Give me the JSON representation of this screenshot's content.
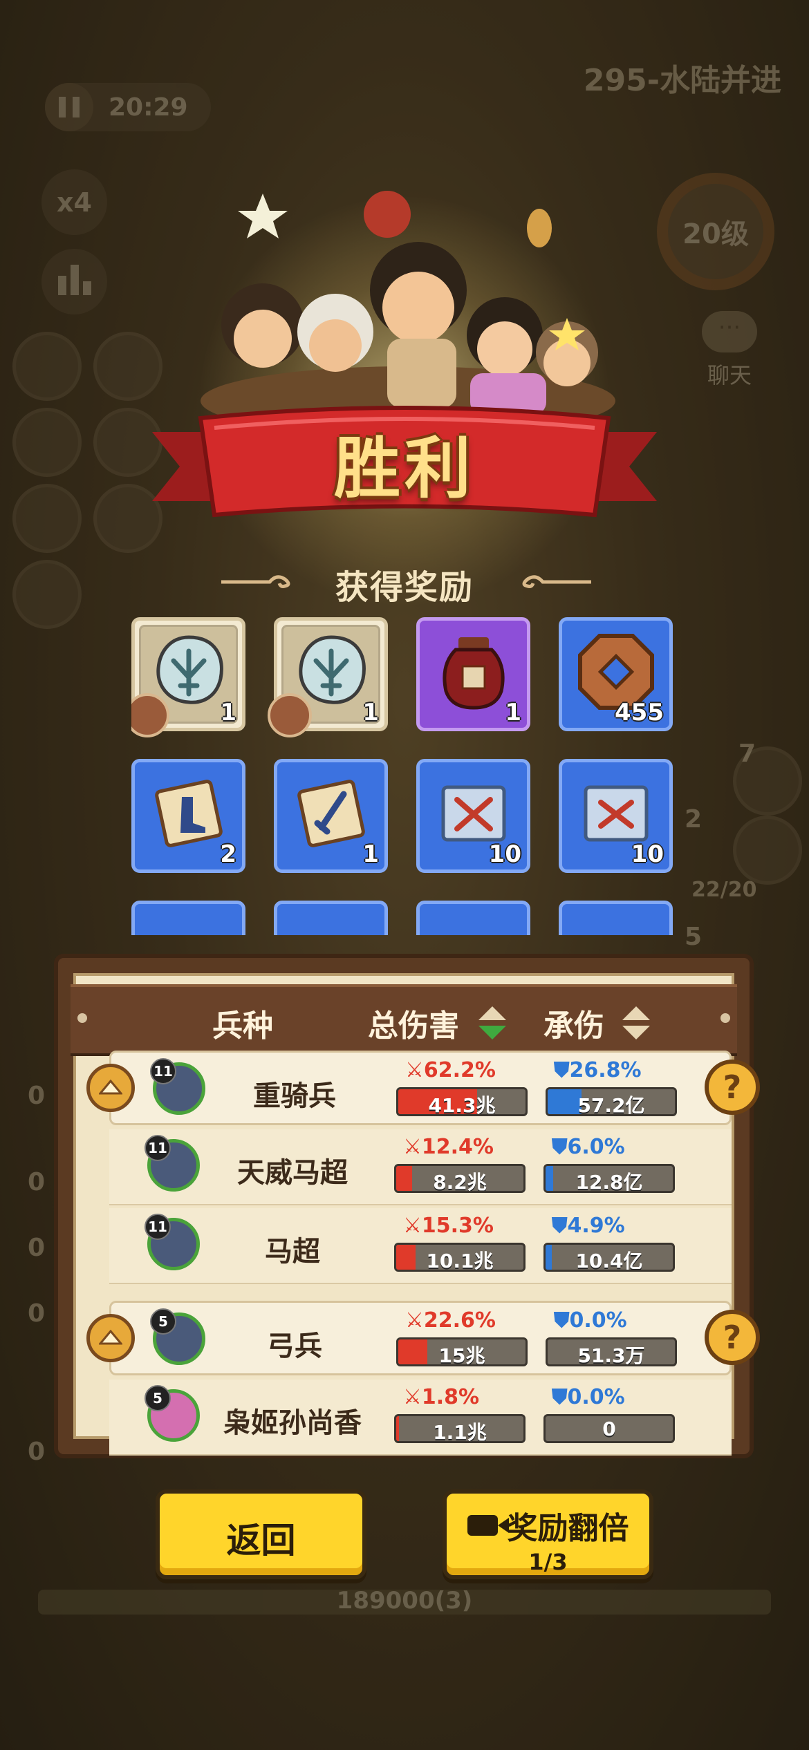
{
  "hud": {
    "stage_title": "295-水陆并进",
    "timer": "20:29",
    "speed": "x4",
    "level": "20级",
    "chat_label": "聊天",
    "side_numbers": [
      "7",
      "2",
      "22/20",
      "5",
      "0",
      "0",
      "0",
      "0",
      "0"
    ],
    "bottom_hp": "189000(3)"
  },
  "victory": {
    "title": "胜利",
    "reward_heading": "获得奖励"
  },
  "rewards": [
    {
      "icon": "trident-token-icon",
      "count": "1",
      "bg": "cream"
    },
    {
      "icon": "trident-token-icon",
      "count": "1",
      "bg": "cream"
    },
    {
      "icon": "wine-jar-icon",
      "count": "1",
      "bg": "purple"
    },
    {
      "icon": "copper-coin-icon",
      "count": "455",
      "bg": "blue"
    },
    {
      "icon": "boot-scroll-icon",
      "count": "2",
      "bg": "blue"
    },
    {
      "icon": "sword-scroll-icon",
      "count": "1",
      "bg": "blue"
    },
    {
      "icon": "crossbow-scroll-icon",
      "count": "10",
      "bg": "blue"
    },
    {
      "icon": "crossed-swords-scroll-icon",
      "count": "10",
      "bg": "blue"
    }
  ],
  "stats": {
    "headers": {
      "unit": "兵种",
      "damage": "总伤害",
      "taken": "承伤"
    },
    "rows": [
      {
        "type": "group",
        "level": "11",
        "name": "重骑兵",
        "dmg_pct": "62.2%",
        "dmg_val": "41.3兆",
        "dmg_frac": 0.622,
        "tak_pct": "26.8%",
        "tak_val": "57.2亿",
        "tak_frac": 0.268
      },
      {
        "type": "child",
        "level": "11",
        "name": "天威马超",
        "dmg_pct": "12.4%",
        "dmg_val": "8.2兆",
        "dmg_frac": 0.124,
        "tak_pct": "6.0%",
        "tak_val": "12.8亿",
        "tak_frac": 0.06
      },
      {
        "type": "child",
        "level": "11",
        "name": "马超",
        "dmg_pct": "15.3%",
        "dmg_val": "10.1兆",
        "dmg_frac": 0.153,
        "tak_pct": "4.9%",
        "tak_val": "10.4亿",
        "tak_frac": 0.049
      },
      {
        "type": "group",
        "level": "5",
        "name": "弓兵",
        "dmg_pct": "22.6%",
        "dmg_val": "15兆",
        "dmg_frac": 0.226,
        "tak_pct": "0.0%",
        "tak_val": "51.3万",
        "tak_frac": 0.0
      },
      {
        "type": "child",
        "level": "5",
        "name": "枭姬孙尚香",
        "dmg_pct": "1.8%",
        "dmg_val": "1.1兆",
        "dmg_frac": 0.018,
        "tak_pct": "0.0%",
        "tak_val": "0",
        "tak_frac": 0.0
      }
    ]
  },
  "buttons": {
    "back": "返回",
    "double": "奖励翻倍",
    "double_progress": "1/3"
  },
  "colors": {
    "damage": "#e03a2a",
    "taken": "#2f79d6",
    "button": "#ffd52b"
  }
}
